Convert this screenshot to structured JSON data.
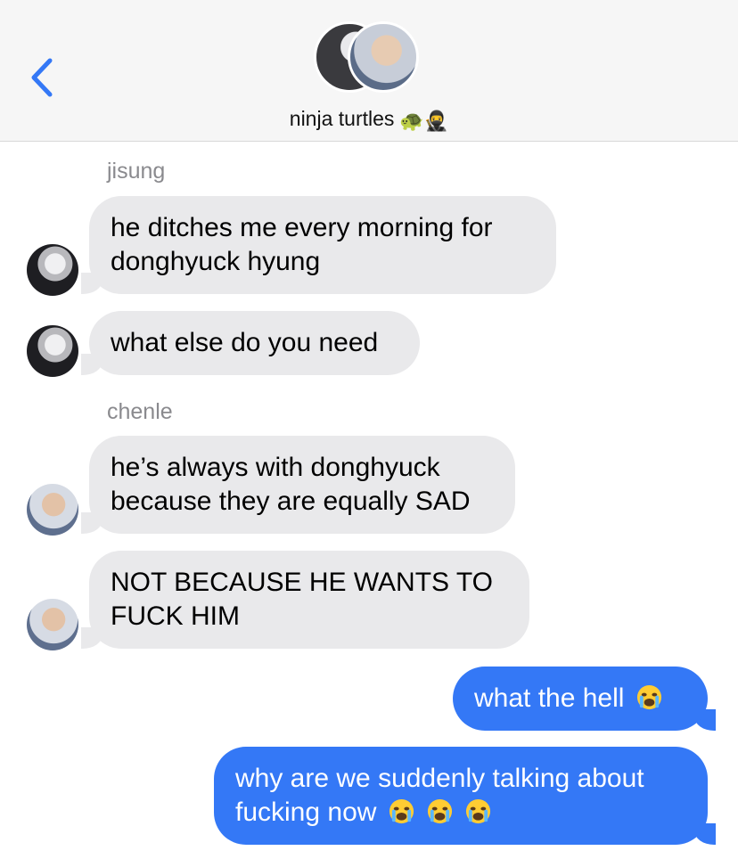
{
  "header": {
    "group_name": "ninja turtles",
    "name_emoji": "🐢🥷"
  },
  "messages": [
    {
      "sender": "jisung",
      "text": "he ditches me every morning for donghyuck hyung"
    },
    {
      "text": "what else do you need"
    },
    {
      "sender": "chenle",
      "text": "he’s always with donghyuck because they are equally SAD"
    },
    {
      "text": "NOT BECAUSE HE WANTS TO FUCK HIM"
    },
    {
      "text": "what the hell",
      "emoji": "😭"
    },
    {
      "text": "why are we suddenly talking about fucking now",
      "emoji": "😭😭😭"
    }
  ],
  "colors": {
    "incoming": "#e9e9eb",
    "outgoing": "#3478f6",
    "accent": "#3478f6"
  },
  "icons": [
    "back-chevron-icon",
    "loudly-crying-face-icon"
  ]
}
